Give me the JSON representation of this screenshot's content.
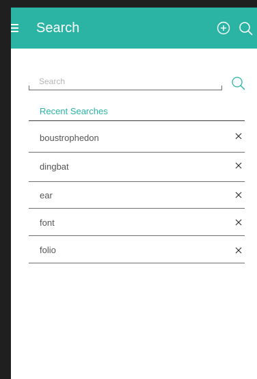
{
  "app_bar": {
    "title": "Search",
    "background": "#2bb3a3",
    "left_icon": "menu-icon",
    "right_icons": [
      "add-circle-icon",
      "search-icon"
    ]
  },
  "search": {
    "placeholder": "Search",
    "value": "",
    "button_icon": "search-icon"
  },
  "recent": {
    "title": "Recent Searches",
    "items": [
      {
        "label": "boustrophedon",
        "remove_icon": "close-icon"
      },
      {
        "label": "dingbat",
        "remove_icon": "close-icon"
      },
      {
        "label": "ear",
        "remove_icon": "close-icon"
      },
      {
        "label": "font",
        "remove_icon": "close-icon"
      },
      {
        "label": "folio",
        "remove_icon": "close-icon"
      }
    ]
  },
  "colors": {
    "accent": "#2bb3a3",
    "text": "#555555",
    "divider": "#6e6e6e"
  }
}
